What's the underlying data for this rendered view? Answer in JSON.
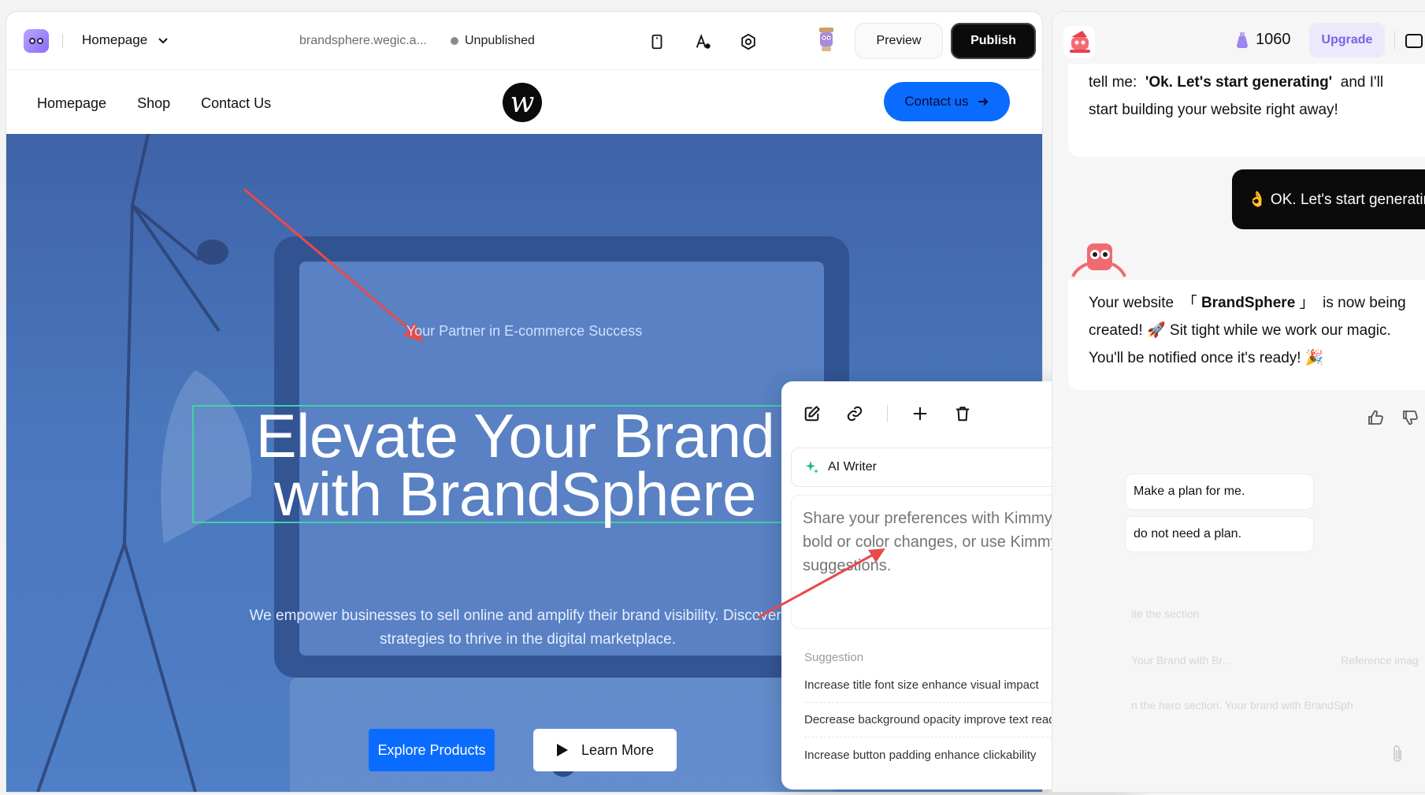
{
  "topbar": {
    "page_selector": "Homepage",
    "site_url": "brandsphere.wegic.a...",
    "status": "Unpublished",
    "preview_label": "Preview",
    "publish_label": "Publish"
  },
  "site_header": {
    "nav": [
      "Homepage",
      "Shop",
      "Contact Us"
    ],
    "logo_letter": "w",
    "contact_button": "Contact us"
  },
  "hero": {
    "tagline": "Your Partner in E-commerce Success",
    "title_line1": "Elevate Your Brand",
    "title_line2": "with BrandSphere",
    "description_line1": "We empower businesses to sell online and amplify their brand visibility. Discover the",
    "description_line2": "strategies to thrive in the digital marketplace.",
    "explore_label": "Explore Products",
    "learn_label": "Learn More"
  },
  "edit_panel": {
    "ai_writer_label": "AI Writer",
    "input_placeholder": "Share your preferences with Kimmy, like bold or color changes, or use Kimmy's suggestions.",
    "suggestion_label": "Suggestion",
    "suggestions": [
      "Increase title font size enhance visual impact",
      "Decrease background opacity improve text readability",
      "Increase button padding enhance clickability"
    ]
  },
  "chat": {
    "credits": "1060",
    "upgrade_label": "Upgrade",
    "msg1_prefix": "tell me:",
    "msg1_bold": "'Ok. Let's start generating'",
    "msg1_suffix": "and I'll",
    "msg1_line2": "start building your website right away!",
    "user_reply": "👌 OK. Let's start generating",
    "msg3_prefix": "Your website",
    "msg3_open": "「",
    "msg3_bold": "BrandSphere",
    "msg3_close": "」",
    "msg3_suffix": "is now being",
    "msg3_line2_a": "created!",
    "msg3_emoji1": "🚀",
    "msg3_line2_b": "Sit tight while we work our magic.",
    "msg3_line3": "You'll be notified once it's ready!",
    "msg3_emoji2": "🎉",
    "quick_replies": [
      "Make a plan for me.",
      "do not need a plan."
    ],
    "faded_1": "ite the section",
    "faded_2": "Your Brand with Br...",
    "faded_3": "Reference imag",
    "faded_4": "n the hero section. Your brand with BrandSph"
  },
  "colors": {
    "accent_blue": "#0a6cff",
    "publish_bg": "#0b0b0c",
    "upgrade_text": "#7b61e6",
    "hero_bg": "#4a77bd",
    "selection_border": "#3ed3a4"
  }
}
